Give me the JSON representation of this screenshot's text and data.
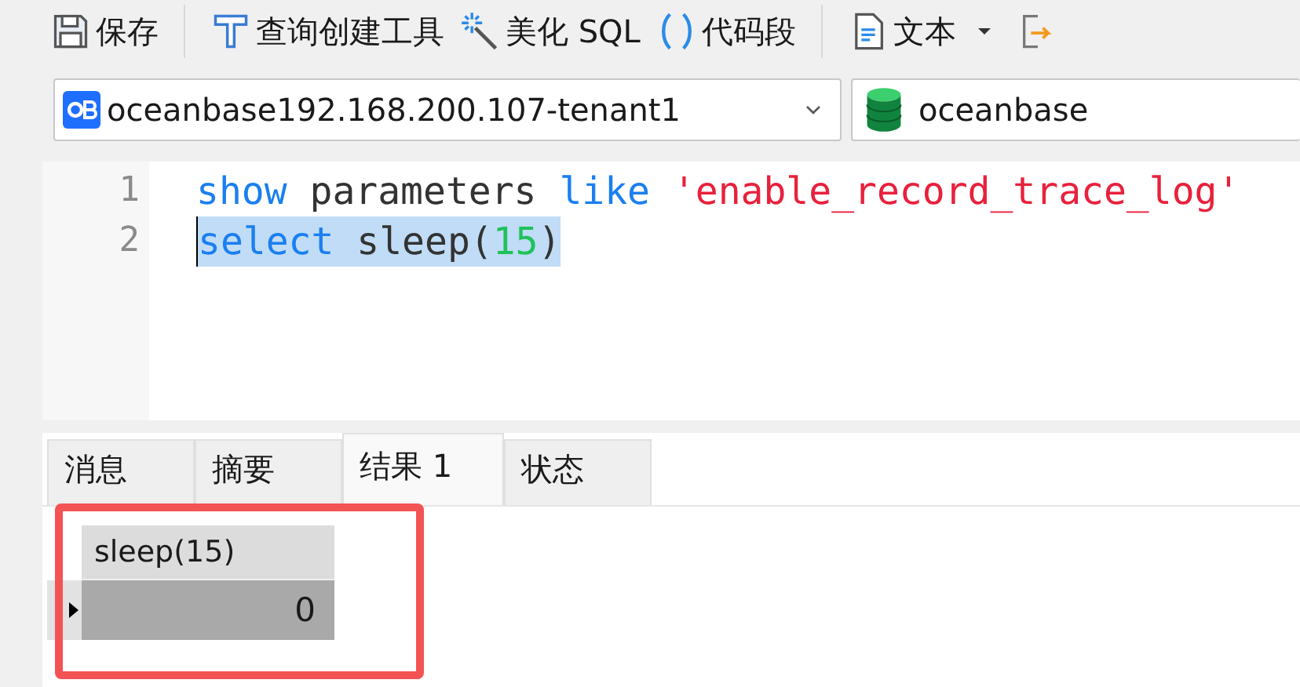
{
  "toolbar": {
    "items": [
      {
        "kind": "save",
        "label": "保存"
      },
      {
        "kind": "builder",
        "label": "查询创建工具"
      },
      {
        "kind": "beautify",
        "label": "美化 SQL"
      },
      {
        "kind": "snippet",
        "label": "代码段"
      },
      {
        "kind": "text",
        "label": "文本"
      },
      {
        "kind": "export"
      }
    ]
  },
  "connection": {
    "value": "oceanbase192.168.200.107-tenant1"
  },
  "database": {
    "value": "oceanbase"
  },
  "editor": {
    "lines": [
      {
        "number": "1",
        "selected": false,
        "tokens": [
          {
            "kind": "keyword",
            "text": "show"
          },
          {
            "kind": "plain",
            "text": " parameters "
          },
          {
            "kind": "keyword",
            "text": "like "
          },
          {
            "kind": "string",
            "text": "'enable_record_trace_log'"
          }
        ]
      },
      {
        "number": "2",
        "selected": true,
        "tokens": [
          {
            "kind": "keyword",
            "text": "select"
          },
          {
            "kind": "plain",
            "text": " sleep("
          },
          {
            "kind": "number",
            "text": "15"
          },
          {
            "kind": "plain",
            "text": ")"
          }
        ]
      }
    ]
  },
  "result_tabs": [
    {
      "label": "消息",
      "selected": false
    },
    {
      "label": "摘要",
      "selected": false
    },
    {
      "label": "结果 1",
      "selected": true
    },
    {
      "label": "状态",
      "selected": false
    }
  ],
  "grid": {
    "columns": [
      "sleep(15)"
    ],
    "rows": [
      {
        "cells": [
          "0"
        ],
        "selected": true
      }
    ]
  },
  "annotation": {
    "kind": "highlight-box"
  }
}
